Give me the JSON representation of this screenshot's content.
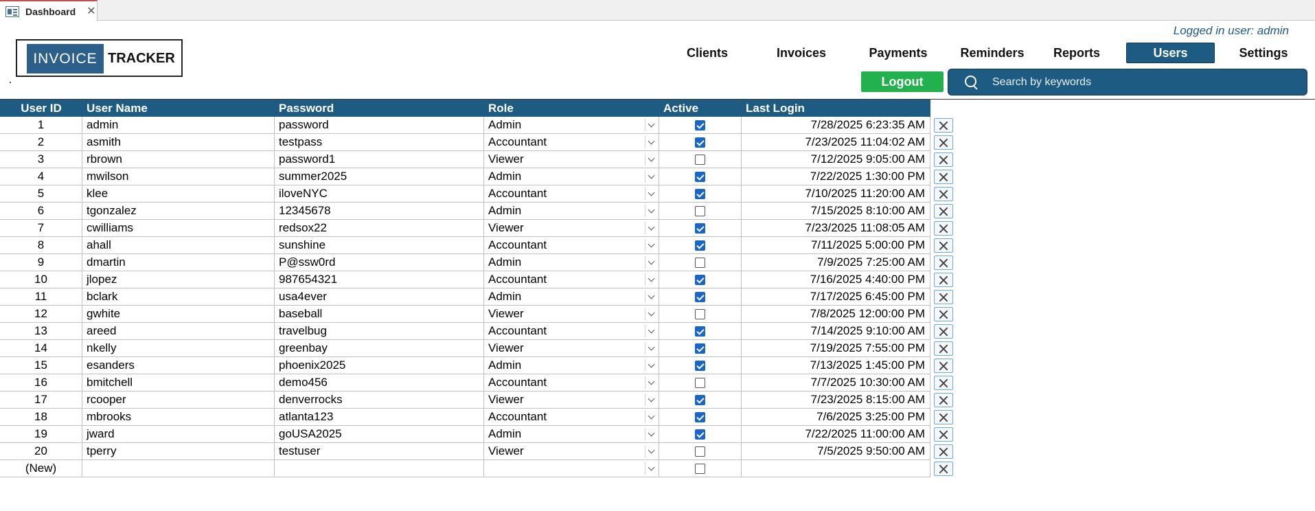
{
  "window": {
    "tab_title": "Dashboard",
    "tab_icon": "form-icon",
    "close_icon": "close-icon"
  },
  "logo": {
    "part1": "INVOICE",
    "part2": "TRACKER",
    "accent": "#2c5f8a"
  },
  "header": {
    "logged_in_text": "Logged in user: admin",
    "nav": [
      "Clients",
      "Invoices",
      "Payments",
      "Reminders",
      "Reports",
      "Users",
      "Settings"
    ],
    "active_nav": "Users",
    "logout_label": "Logout",
    "search_placeholder": "Search by keywords",
    "colors": {
      "primary": "#1e5b83",
      "logout": "#22b14c"
    }
  },
  "table": {
    "columns": [
      "User ID",
      "User Name",
      "Password",
      "Role",
      "Active",
      "Last Login"
    ],
    "rows": [
      {
        "id": "1",
        "name": "admin",
        "password": "password",
        "role": "Admin",
        "active": true,
        "last_login": "7/28/2025 6:23:35 AM"
      },
      {
        "id": "2",
        "name": "asmith",
        "password": "testpass",
        "role": "Accountant",
        "active": true,
        "last_login": "7/23/2025 11:04:02 AM"
      },
      {
        "id": "3",
        "name": "rbrown",
        "password": "password1",
        "role": "Viewer",
        "active": false,
        "last_login": "7/12/2025 9:05:00 AM"
      },
      {
        "id": "4",
        "name": "mwilson",
        "password": "summer2025",
        "role": "Admin",
        "active": true,
        "last_login": "7/22/2025 1:30:00 PM"
      },
      {
        "id": "5",
        "name": "klee",
        "password": "iloveNYC",
        "role": "Accountant",
        "active": true,
        "last_login": "7/10/2025 11:20:00 AM"
      },
      {
        "id": "6",
        "name": "tgonzalez",
        "password": "12345678",
        "role": "Admin",
        "active": false,
        "last_login": "7/15/2025 8:10:00 AM"
      },
      {
        "id": "7",
        "name": "cwilliams",
        "password": "redsox22",
        "role": "Viewer",
        "active": true,
        "last_login": "7/23/2025 11:08:05 AM"
      },
      {
        "id": "8",
        "name": "ahall",
        "password": "sunshine",
        "role": "Accountant",
        "active": true,
        "last_login": "7/11/2025 5:00:00 PM"
      },
      {
        "id": "9",
        "name": "dmartin",
        "password": "P@ssw0rd",
        "role": "Admin",
        "active": false,
        "last_login": "7/9/2025 7:25:00 AM"
      },
      {
        "id": "10",
        "name": "jlopez",
        "password": "987654321",
        "role": "Accountant",
        "active": true,
        "last_login": "7/16/2025 4:40:00 PM"
      },
      {
        "id": "11",
        "name": "bclark",
        "password": "usa4ever",
        "role": "Admin",
        "active": true,
        "last_login": "7/17/2025 6:45:00 PM"
      },
      {
        "id": "12",
        "name": "gwhite",
        "password": "baseball",
        "role": "Viewer",
        "active": false,
        "last_login": "7/8/2025 12:00:00 PM"
      },
      {
        "id": "13",
        "name": "areed",
        "password": "travelbug",
        "role": "Accountant",
        "active": true,
        "last_login": "7/14/2025 9:10:00 AM"
      },
      {
        "id": "14",
        "name": "nkelly",
        "password": "greenbay",
        "role": "Viewer",
        "active": true,
        "last_login": "7/19/2025 7:55:00 PM"
      },
      {
        "id": "15",
        "name": "esanders",
        "password": "phoenix2025",
        "role": "Admin",
        "active": true,
        "last_login": "7/13/2025 1:45:00 PM"
      },
      {
        "id": "16",
        "name": "bmitchell",
        "password": "demo456",
        "role": "Accountant",
        "active": false,
        "last_login": "7/7/2025 10:30:00 AM"
      },
      {
        "id": "17",
        "name": "rcooper",
        "password": "denverrocks",
        "role": "Viewer",
        "active": true,
        "last_login": "7/23/2025 8:15:00 AM"
      },
      {
        "id": "18",
        "name": "mbrooks",
        "password": "atlanta123",
        "role": "Accountant",
        "active": true,
        "last_login": "7/6/2025 3:25:00 PM"
      },
      {
        "id": "19",
        "name": "jward",
        "password": "goUSA2025",
        "role": "Admin",
        "active": true,
        "last_login": "7/22/2025 11:00:00 AM"
      },
      {
        "id": "20",
        "name": "tperry",
        "password": "testuser",
        "role": "Viewer",
        "active": false,
        "last_login": "7/5/2025 9:50:00 AM"
      }
    ],
    "new_row_label": "(New)",
    "delete_icon": "delete-x-icon"
  }
}
